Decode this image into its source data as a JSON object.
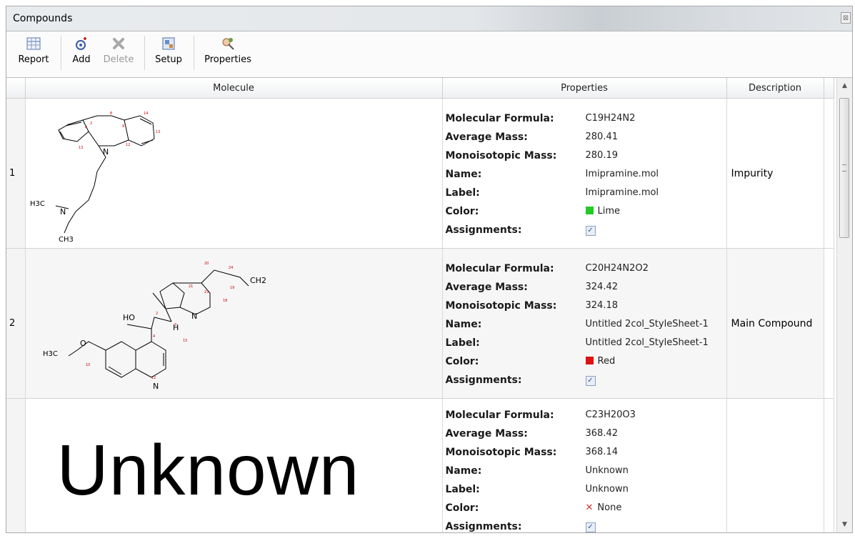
{
  "window": {
    "title": "Compounds",
    "close_glyph": "⊠"
  },
  "toolbar": {
    "report_label": "Report",
    "add_label": "Add",
    "delete_label": "Delete",
    "setup_label": "Setup",
    "properties_label": "Properties"
  },
  "table": {
    "columns": {
      "molecule": "Molecule",
      "properties": "Properties",
      "description": "Description"
    },
    "property_labels": {
      "formula": "Molecular Formula:",
      "avg": "Average Mass:",
      "mono": "Monoisotopic Mass:",
      "name": "Name:",
      "label": "Label:",
      "color": "Color:",
      "assignments": "Assignments:"
    },
    "rows": [
      {
        "number": "1",
        "formula": "C19H24N2",
        "average_mass": "280.41",
        "monoisotopic_mass": "280.19",
        "name": "Imipramine.mol",
        "label": "Imipramine.mol",
        "color_name": "Lime",
        "color_hex": "#22cc22",
        "assignments": true,
        "description": "Impurity"
      },
      {
        "number": "2",
        "formula": "C20H24N2O2",
        "average_mass": "324.42",
        "monoisotopic_mass": "324.18",
        "name": "Untitled 2col_StyleSheet-1",
        "label": "Untitled 2col_StyleSheet-1",
        "color_name": "Red",
        "color_hex": "#dd1111",
        "assignments": true,
        "description": "Main Compound"
      },
      {
        "number": "",
        "molecule_text": "Unknown",
        "formula": "C23H20O3",
        "average_mass": "368.42",
        "monoisotopic_mass": "368.14",
        "name": "Unknown",
        "label": "Unknown",
        "color_name": "None",
        "color_hex": "",
        "assignments": true,
        "description": ""
      }
    ]
  },
  "molecule_labels": {
    "row1": {
      "n_ring": "N",
      "n_chain": "N",
      "h3c": "H3C",
      "ch3": "CH3"
    },
    "row2": {
      "ho": "HO",
      "n_bridge": "N",
      "h": "H",
      "ch2": "CH2",
      "n_ring": "N",
      "h3c": "H3C",
      "o": "O"
    }
  },
  "checkbox_glyph": "✓",
  "none_glyph": "✕"
}
